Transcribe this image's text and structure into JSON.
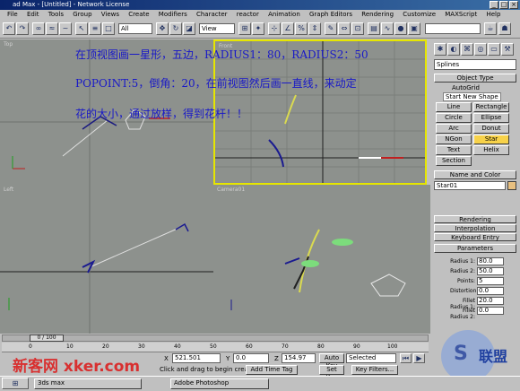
{
  "window": {
    "title": "ad Max - [Untitled] - Network License"
  },
  "menu": [
    "File",
    "Edit",
    "Tools",
    "Group",
    "Views",
    "Create",
    "Modifiers",
    "Character",
    "reactor",
    "Animation",
    "Graph Editors",
    "Rendering",
    "Customize",
    "MAXScript",
    "Help"
  ],
  "toolbar": {
    "selection_filter": "All",
    "view_combo": "View",
    "named_sel": ""
  },
  "viewports": {
    "top": {
      "label": "Top"
    },
    "front": {
      "label": "Front"
    },
    "left": {
      "label": "Left"
    },
    "camera": {
      "label": "Camera01"
    }
  },
  "annotation": {
    "line1": "在顶视图画一星形，五边，RADIUS1：80，RADIUS2：50",
    "line2": "POPOINT:5，倒角：20，在前视图然后画一直线，来动定",
    "line3": "花的大小，通过放样，得到花杆！！"
  },
  "command_panel": {
    "category": "Splines",
    "object_type_title": "Object Type",
    "autogrid": "AutoGrid",
    "start_new_shape": "Start New Shape",
    "buttons": [
      "Line",
      "Rectangle",
      "Circle",
      "Ellipse",
      "Arc",
      "Donut",
      "NGon",
      "Star",
      "Text",
      "Helix",
      "Section"
    ],
    "selected_button": "Star",
    "name_color_title": "Name and Color",
    "object_name": "Star01",
    "rollouts": [
      "Rendering",
      "Interpolation",
      "Keyboard Entry",
      "Parameters"
    ],
    "params": [
      {
        "label": "Radius 1:",
        "value": "80.0"
      },
      {
        "label": "Radius 2:",
        "value": "50.0"
      },
      {
        "label": "Points:",
        "value": "5"
      },
      {
        "label": "Distortion:",
        "value": "0.0"
      },
      {
        "label": "Fillet Radius 1:",
        "value": "20.0"
      },
      {
        "label": "Fillet Radius 2:",
        "value": "0.0"
      }
    ]
  },
  "timeline": {
    "frame": "0 / 100",
    "ticks": [
      "0",
      "10",
      "20",
      "30",
      "40",
      "50",
      "60",
      "70",
      "80",
      "90",
      "100"
    ]
  },
  "status": {
    "x_label": "X",
    "x_value": "521.501",
    "y_label": "Y",
    "y_value": "0.0",
    "z_label": "Z",
    "z_value": "154.97",
    "prompt": "Click and drag to begin creation process",
    "add_time_tag": "Add Time Tag",
    "auto_key": "Auto Key",
    "set_key": "Set Key",
    "selected": "Selected",
    "key_filters": "Key Filters..."
  },
  "watermark": {
    "left": "新客网 xker.com",
    "right": "联盟"
  },
  "taskbar": {
    "item1": "3ds max",
    "item2": "Adobe Photoshop"
  }
}
